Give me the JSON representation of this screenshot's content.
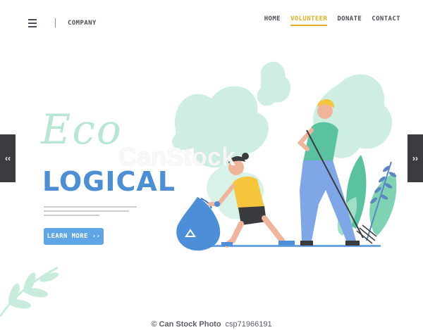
{
  "header": {
    "company": "COMPANY",
    "nav": [
      {
        "label": "HOME",
        "active": false
      },
      {
        "label": "VOLUNTEER",
        "active": true
      },
      {
        "label": "DONATE",
        "active": false
      },
      {
        "label": "CONTACT",
        "active": false
      }
    ]
  },
  "arrows": {
    "left": "‹‹",
    "right": "››"
  },
  "hero": {
    "title_top": "Eco",
    "title_bottom": "LOGICAL",
    "button": "LEARN MORE ››"
  },
  "watermark": {
    "center": "CanStock",
    "footer_brand": "© Can Stock Photo",
    "footer_id": "csp71966191"
  },
  "colors": {
    "accent": "#e2b021",
    "primary": "#4d8fd4",
    "button": "#5fa6e6",
    "leaf": "#b7e6d2"
  },
  "icons": [
    "menu-icon",
    "recycle-icon",
    "double-chevron-left-icon",
    "double-chevron-right-icon"
  ]
}
